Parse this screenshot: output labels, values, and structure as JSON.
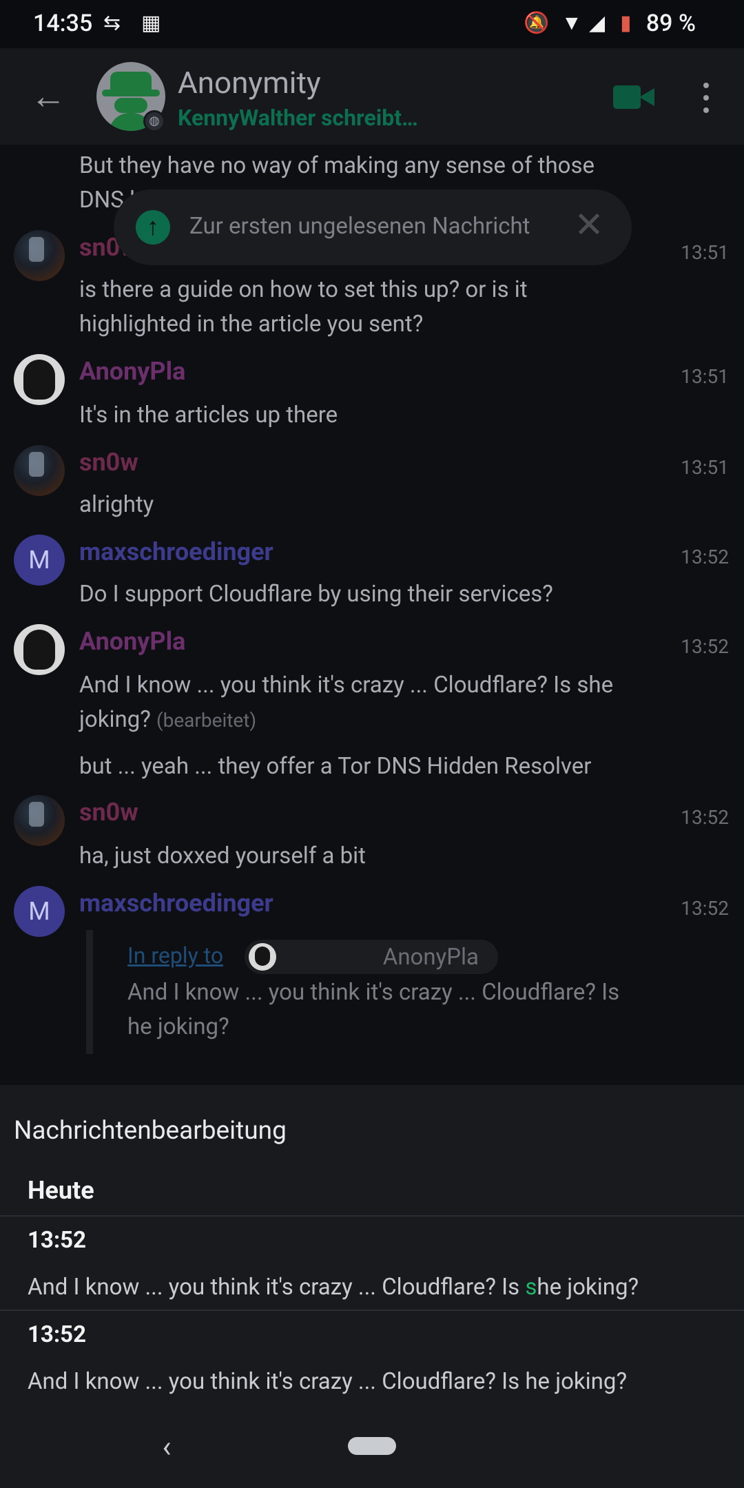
{
  "status_bar": {
    "time": "14:35",
    "battery": "89 %",
    "icons": [
      "sync-icon",
      "grid-icon",
      "notifications-off-icon",
      "wifi-icon",
      "signal-icon",
      "battery-icon"
    ]
  },
  "header": {
    "back_icon": "arrow-back-icon",
    "room_name": "Anonymity",
    "typing": "KennyWalther schreibt…",
    "video_icon": "video-call-icon",
    "more_icon": "more-vert-icon"
  },
  "jump_bar": {
    "label": "Zur ersten ungelesenen Nachricht",
    "icon": "arrow-up-icon",
    "close_icon": "close-icon"
  },
  "timeline": {
    "partial_msg_line1": "But they have no way of making any sense of those",
    "partial_msg_line2": "DNS l",
    "messages": [
      {
        "sender": "sn0w",
        "time": "13:51",
        "line1": "is there a guide on how to set this up? or is it",
        "line2": "highlighted in the article you sent?"
      },
      {
        "sender": "AnonyPla",
        "time": "13:51",
        "line1": "It's in the articles up there"
      },
      {
        "sender": "sn0w",
        "time": "13:51",
        "line1": "alrighty"
      },
      {
        "sender": "maxschroedinger",
        "avatar_letter": "M",
        "time": "13:52",
        "line1": "Do I support Cloudflare by using their services?"
      },
      {
        "sender": "AnonyPla",
        "time": "13:52",
        "line1": "And I know ... you think it's crazy ... Cloudflare? Is she",
        "line2": "joking?",
        "edited": "(bearbeitet)",
        "followup": "but ... yeah ... they offer a Tor DNS Hidden Resolver"
      },
      {
        "sender": "sn0w",
        "time": "13:52",
        "line1": "ha, just doxxed yourself a bit"
      },
      {
        "sender": "maxschroedinger",
        "avatar_letter": "M",
        "time": "13:52"
      }
    ],
    "reply": {
      "link": "In reply to",
      "name": "AnonyPla",
      "line1": "And I know ... you think it's crazy ... Cloudflare? Is",
      "line2": "he joking?"
    }
  },
  "sheet": {
    "title": "Nachrichtenbearbeitung",
    "day": "Heute",
    "entries": [
      {
        "time": "13:52",
        "before": "And I know ... you think it's crazy ... Cloudflare? Is ",
        "highlight": "s",
        "after": "he joking?"
      },
      {
        "time": "13:52",
        "text": "And I know ... you think it's crazy ... Cloudflare? Is he joking?"
      }
    ]
  },
  "nav_bar": {
    "back_icon": "nav-back-icon",
    "home_icon": "home-pill-icon"
  }
}
